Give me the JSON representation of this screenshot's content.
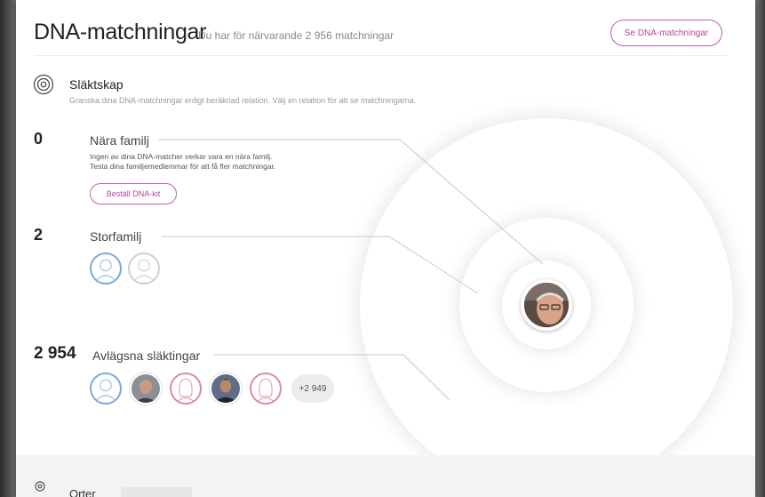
{
  "header": {
    "title": "DNA-matchningar",
    "subtitle": "Du har för närvarande 2 956 matchningar",
    "see_matches_label": "Se DNA-matchningar"
  },
  "section": {
    "title": "Släktskap",
    "description": "Granska dina DNA-matchningar enligt beräknad relation. Välj en relation för att se matchningarna."
  },
  "groups": {
    "close_family": {
      "count": "0",
      "title": "Nära familj",
      "desc_line1": "Ingen av dina DNA-matcher verkar vara en nära familj.",
      "desc_line2": "Testa dina familjemedlemmar för att få fler matchningar.",
      "order_kit_label": "Beställ DNA-kit"
    },
    "extended_family": {
      "count": "2",
      "title": "Storfamilj"
    },
    "distant_relatives": {
      "count": "2 954",
      "title": "Avlägsna släktingar",
      "more_label": "+2 949"
    }
  },
  "footer": {
    "title": "Orter"
  },
  "colors": {
    "accent": "#b8469e",
    "male": "#7aa9d6",
    "female": "#d98c9a"
  }
}
